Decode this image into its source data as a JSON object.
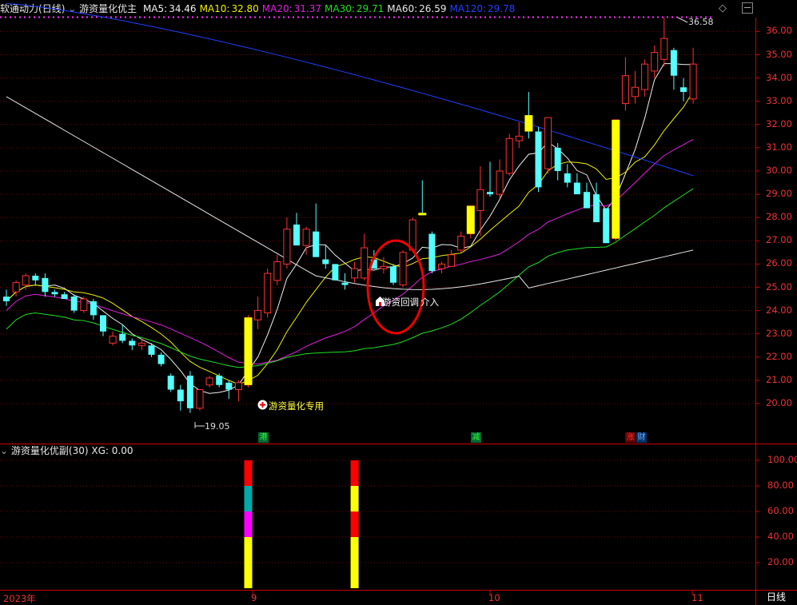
{
  "header": {
    "stock_name": "软通动力",
    "period": "(日线)",
    "indicator": "游资量化优主",
    "ma": [
      {
        "label": "MA5:",
        "value": "34.46",
        "color": "#f0f0f0"
      },
      {
        "label": "MA10:",
        "value": "32.80",
        "color": "#f0f000"
      },
      {
        "label": "MA20:",
        "value": "31.37",
        "color": "#e020e0"
      },
      {
        "label": "MA30:",
        "value": "29.71",
        "color": "#20e020"
      },
      {
        "label": "MA60:",
        "value": "26.59",
        "color": "#e8e8e8"
      },
      {
        "label": "MA120:",
        "value": "29.78",
        "color": "#2040ff"
      }
    ]
  },
  "sub_header": {
    "indicator": "游资量化优副(30)",
    "xg_label": "XG:",
    "xg_value": "0.00"
  },
  "annotations": {
    "high_price": "36.58",
    "low_price": "19.05",
    "signal_1": "游资量化专用",
    "signal_2": "游资回调",
    "signal_2_suffix": "介入",
    "tag_1": "港",
    "tag_2": "减",
    "tag_3a": "涨",
    "tag_3b": "财"
  },
  "x_axis": {
    "year": "2023年",
    "months": [
      "9",
      "10",
      "11"
    ]
  },
  "timeframe_label": "日线",
  "colors": {
    "up": "#ff3232",
    "down": "#54ffff",
    "signal": "#ffff00",
    "grid": "#7a0000",
    "axis": "#c80000"
  },
  "chart_data": [
    {
      "type": "candlestick",
      "title": "软通动力 (日线)",
      "y_ticks": [
        20,
        21,
        22,
        23,
        24,
        25,
        26,
        27,
        28,
        29,
        30,
        31,
        32,
        33,
        34,
        35,
        36
      ],
      "ylim": [
        19.0,
        37.0
      ],
      "candles": [
        [
          24.6,
          24.9,
          24.2,
          24.4
        ],
        [
          24.8,
          25.3,
          24.6,
          25.2
        ],
        [
          25.1,
          25.6,
          24.9,
          25.5
        ],
        [
          25.5,
          25.6,
          25.1,
          25.3
        ],
        [
          25.4,
          25.6,
          24.6,
          24.8
        ],
        [
          24.8,
          24.9,
          24.6,
          24.7
        ],
        [
          24.7,
          24.8,
          24.5,
          24.5
        ],
        [
          24.6,
          24.7,
          23.9,
          24.0
        ],
        [
          24.0,
          24.6,
          23.9,
          24.5
        ],
        [
          24.4,
          24.5,
          23.6,
          23.8
        ],
        [
          23.8,
          23.8,
          22.9,
          23.1
        ],
        [
          22.6,
          23.1,
          22.5,
          22.9
        ],
        [
          23.0,
          23.4,
          22.6,
          22.7
        ],
        [
          22.7,
          22.8,
          22.3,
          22.5
        ],
        [
          22.5,
          22.8,
          22.3,
          22.6
        ],
        [
          22.5,
          22.6,
          22.0,
          22.1
        ],
        [
          22.1,
          22.2,
          21.6,
          21.7
        ],
        [
          21.2,
          21.3,
          20.5,
          20.6
        ],
        [
          20.6,
          20.8,
          19.7,
          20.1
        ],
        [
          21.2,
          21.4,
          19.6,
          19.8
        ],
        [
          19.8,
          20.6,
          19.7,
          20.6
        ],
        [
          20.8,
          21.2,
          20.7,
          21.1
        ],
        [
          21.2,
          21.3,
          20.7,
          20.8
        ],
        [
          20.9,
          21.0,
          20.2,
          20.6
        ],
        [
          20.6,
          21.0,
          20.1,
          20.9
        ],
        [
          20.8,
          23.8,
          20.7,
          23.7
        ],
        [
          23.6,
          24.6,
          23.2,
          24.0
        ],
        [
          23.9,
          25.8,
          23.7,
          25.6
        ],
        [
          25.3,
          26.4,
          25.1,
          26.1
        ],
        [
          26.0,
          28.0,
          25.8,
          27.5
        ],
        [
          27.7,
          28.2,
          26.9,
          26.8
        ],
        [
          26.8,
          27.6,
          26.4,
          27.5
        ],
        [
          27.4,
          28.6,
          26.6,
          26.3
        ],
        [
          26.2,
          26.8,
          25.8,
          26.0
        ],
        [
          26.0,
          26.0,
          25.3,
          25.3
        ],
        [
          25.2,
          25.6,
          24.9,
          25.1
        ],
        [
          25.4,
          26.1,
          25.2,
          25.8
        ],
        [
          25.4,
          27.3,
          25.3,
          26.7
        ],
        [
          26.2,
          26.6,
          25.9,
          25.8
        ],
        [
          25.8,
          26.3,
          25.6,
          25.9
        ],
        [
          25.9,
          26.0,
          25.1,
          25.2
        ],
        [
          25.1,
          26.6,
          25.0,
          26.5
        ],
        [
          26.6,
          28.0,
          26.5,
          27.9
        ],
        [
          28.2,
          29.6,
          28.1,
          28.1
        ],
        [
          27.3,
          27.4,
          25.6,
          25.7
        ],
        [
          25.8,
          26.1,
          25.6,
          26.0
        ],
        [
          25.9,
          26.6,
          25.9,
          26.4
        ],
        [
          26.6,
          27.4,
          26.5,
          27.2
        ],
        [
          27.3,
          28.5,
          27.1,
          28.5
        ],
        [
          28.3,
          30.2,
          27.2,
          29.2
        ],
        [
          29.1,
          30.4,
          28.9,
          29.0
        ],
        [
          29.0,
          30.5,
          28.8,
          30.0
        ],
        [
          29.9,
          31.6,
          29.8,
          31.4
        ],
        [
          31.3,
          32.1,
          31.0,
          31.5
        ],
        [
          32.4,
          33.4,
          31.4,
          31.7
        ],
        [
          31.7,
          31.9,
          29.1,
          29.3
        ],
        [
          30.1,
          32.2,
          29.9,
          32.3
        ],
        [
          31.0,
          31.2,
          29.6,
          30.0
        ],
        [
          29.9,
          30.3,
          29.3,
          29.5
        ],
        [
          29.5,
          29.9,
          29.3,
          29.0
        ],
        [
          29.1,
          29.5,
          28.6,
          28.4
        ],
        [
          29.0,
          29.5,
          27.9,
          27.8
        ],
        [
          28.4,
          28.4,
          27.8,
          26.9
        ],
        [
          27.1,
          32.2,
          27.0,
          32.2
        ],
        [
          32.9,
          34.9,
          32.6,
          34.1
        ],
        [
          33.2,
          34.3,
          32.9,
          33.6
        ],
        [
          33.5,
          34.8,
          33.2,
          34.6
        ],
        [
          34.3,
          35.4,
          34.0,
          35.1
        ],
        [
          34.8,
          36.6,
          34.5,
          35.7
        ],
        [
          35.2,
          35.3,
          33.5,
          34.1
        ],
        [
          33.6,
          34.0,
          33.0,
          33.4
        ],
        [
          33.1,
          35.3,
          32.9,
          34.6
        ]
      ],
      "signal_bar_indices": [
        25,
        43,
        48,
        54,
        63
      ],
      "ma_lines": [
        {
          "name": "MA5",
          "color": "#f0f0f0"
        },
        {
          "name": "MA10",
          "color": "#f0f000"
        },
        {
          "name": "MA20",
          "color": "#e020e0"
        },
        {
          "name": "MA30",
          "color": "#20e020"
        },
        {
          "name": "MA60",
          "color": "#e8e8e8"
        },
        {
          "name": "MA120",
          "color": "#2040ff"
        }
      ]
    },
    {
      "type": "bar",
      "title": "游资量化优副(30)",
      "y_ticks": [
        20.0,
        40.0,
        60.0,
        80.0,
        100.0
      ],
      "y_tick_labels": [
        "20.00",
        "40.00",
        "60.00",
        "80.00",
        "100.00"
      ],
      "ylim": [
        0,
        105
      ],
      "stacks": [
        {
          "index": 25,
          "segments": [
            {
              "from": 0,
              "to": 40,
              "color": "#ffff00"
            },
            {
              "from": 40,
              "to": 60,
              "color": "#ff00ff"
            },
            {
              "from": 60,
              "to": 80,
              "color": "#00aaaa"
            },
            {
              "from": 80,
              "to": 100,
              "color": "#ff0000"
            }
          ]
        },
        {
          "index": 36,
          "segments": [
            {
              "from": 0,
              "to": 40,
              "color": "#ffff00"
            },
            {
              "from": 40,
              "to": 60,
              "color": "#ff0000"
            },
            {
              "from": 60,
              "to": 80,
              "color": "#ffff00"
            },
            {
              "from": 80,
              "to": 100,
              "color": "#ff0000"
            }
          ]
        }
      ]
    }
  ]
}
